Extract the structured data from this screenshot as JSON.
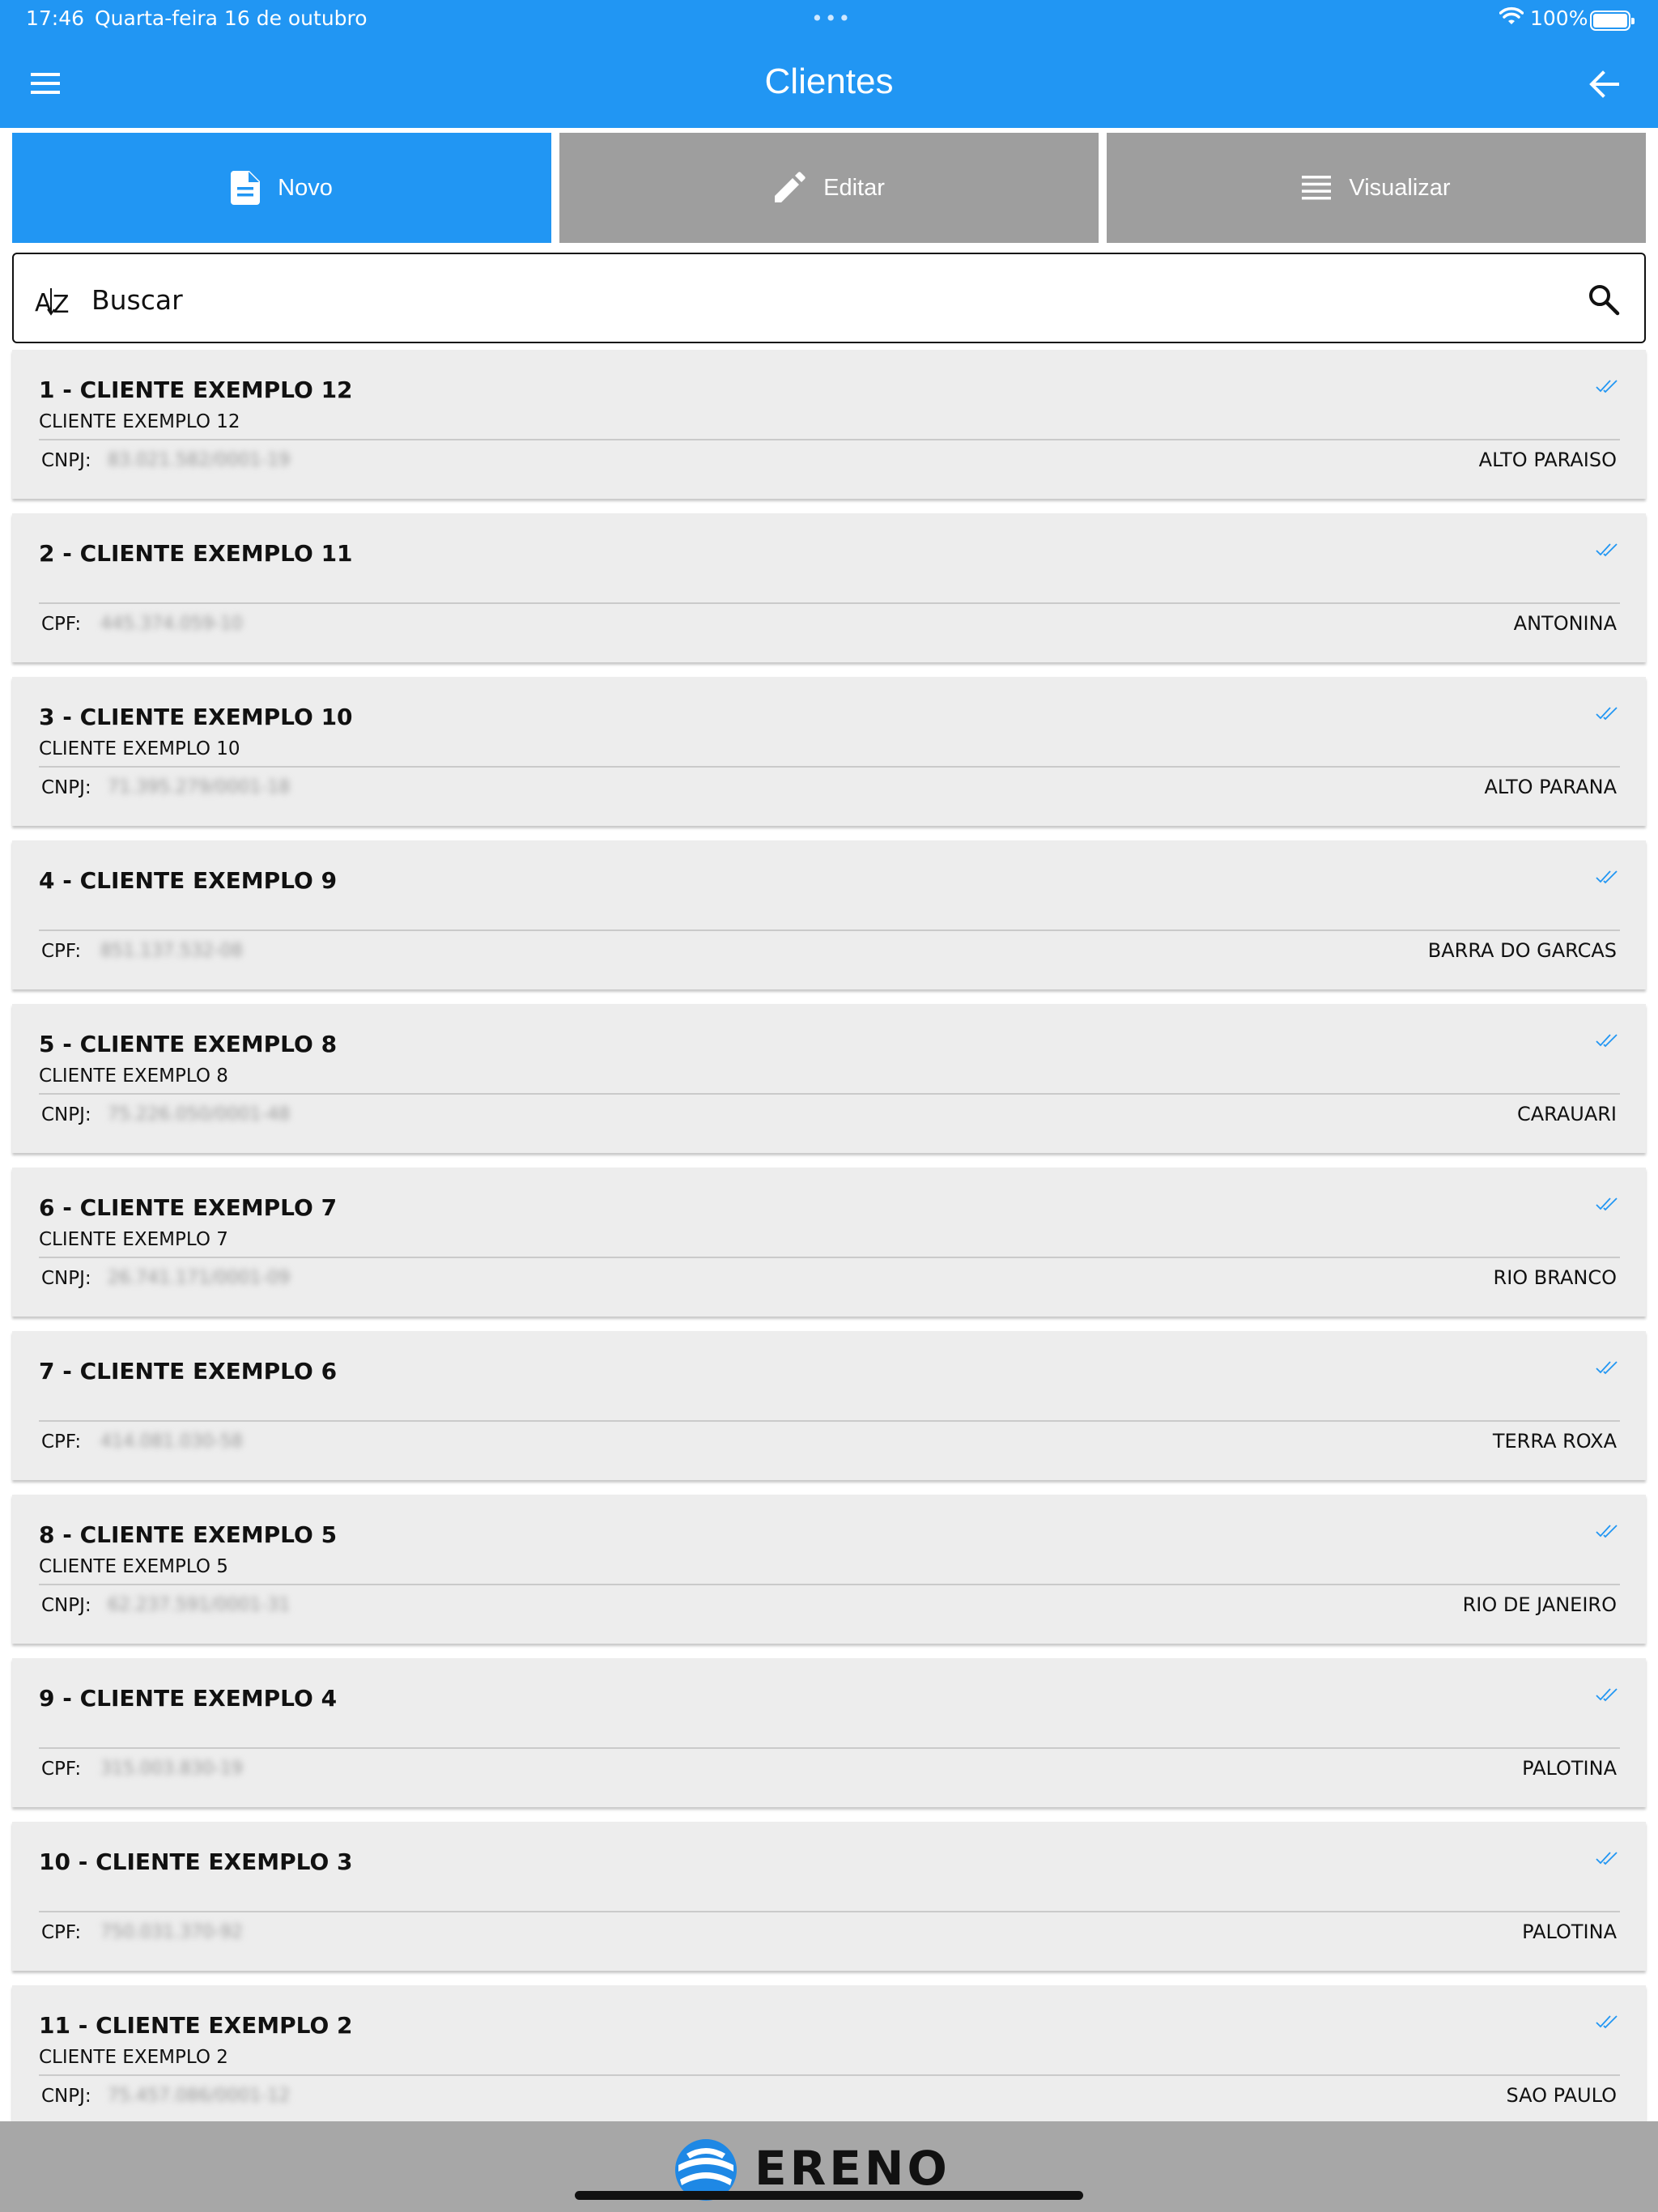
{
  "status_bar": {
    "time": "17:46",
    "date": "Quarta-feira 16 de outubro",
    "battery": "100%"
  },
  "header": {
    "title": "Clientes",
    "menu_icon": "hamburger-menu-icon",
    "back_icon": "arrow-back-icon"
  },
  "actions": {
    "novo": "Novo",
    "editar": "Editar",
    "visualizar": "Visualizar"
  },
  "search": {
    "placeholder": "Buscar",
    "sort_icon": "sort-az-icon",
    "search_icon": "magnifier-icon"
  },
  "colors": {
    "primary": "#2196f3",
    "inactive_button": "#9e9e9e",
    "card_background": "#ededed",
    "footer": "#a7a7a7"
  },
  "clients": [
    {
      "name": "1 - CLIENTE EXEMPLO 12",
      "subtitle": "CLIENTE EXEMPLO 12",
      "doc_label": "CNPJ:",
      "doc_value": "83.021.582/0001-19",
      "city": "ALTO PARAISO"
    },
    {
      "name": "2 - CLIENTE EXEMPLO 11",
      "subtitle": "",
      "doc_label": "CPF:",
      "doc_value": "445.374.059-10",
      "city": "ANTONINA"
    },
    {
      "name": "3 - CLIENTE EXEMPLO 10",
      "subtitle": "CLIENTE EXEMPLO 10",
      "doc_label": "CNPJ:",
      "doc_value": "71.395.279/0001-18",
      "city": "ALTO PARANA"
    },
    {
      "name": "4 - CLIENTE EXEMPLO 9",
      "subtitle": "",
      "doc_label": "CPF:",
      "doc_value": "851.137.532-08",
      "city": "BARRA DO GARCAS"
    },
    {
      "name": "5 - CLIENTE EXEMPLO 8",
      "subtitle": "CLIENTE EXEMPLO 8",
      "doc_label": "CNPJ:",
      "doc_value": "75.226.050/0001-48",
      "city": "CARAUARI"
    },
    {
      "name": "6 - CLIENTE EXEMPLO 7",
      "subtitle": "CLIENTE EXEMPLO 7",
      "doc_label": "CNPJ:",
      "doc_value": "26.741.171/0001-09",
      "city": "RIO BRANCO"
    },
    {
      "name": "7 - CLIENTE EXEMPLO 6",
      "subtitle": "",
      "doc_label": "CPF:",
      "doc_value": "414.081.030-58",
      "city": "TERRA ROXA"
    },
    {
      "name": "8 - CLIENTE EXEMPLO 5",
      "subtitle": "CLIENTE EXEMPLO 5",
      "doc_label": "CNPJ:",
      "doc_value": "62.237.591/0001-31",
      "city": "RIO DE JANEIRO"
    },
    {
      "name": "9 - CLIENTE EXEMPLO 4",
      "subtitle": "",
      "doc_label": "CPF:",
      "doc_value": "315.003.830-19",
      "city": "PALOTINA"
    },
    {
      "name": "10 - CLIENTE EXEMPLO 3",
      "subtitle": "",
      "doc_label": "CPF:",
      "doc_value": "750.031.370-92",
      "city": "PALOTINA"
    },
    {
      "name": "11 - CLIENTE EXEMPLO 2",
      "subtitle": "CLIENTE EXEMPLO 2",
      "doc_label": "CNPJ:",
      "doc_value": "75.457.086/0001-12",
      "city": "SAO PAULO"
    }
  ],
  "footer": {
    "logo_text": "ERENO"
  }
}
